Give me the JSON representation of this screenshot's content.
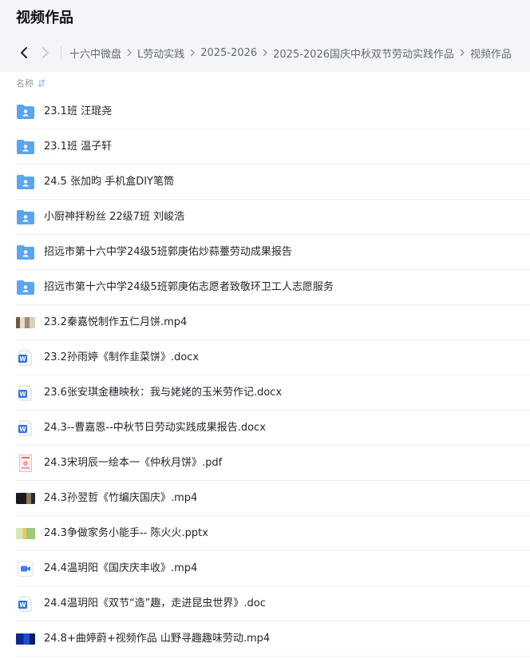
{
  "header": {
    "title": "视频作品"
  },
  "breadcrumb": [
    "十六中微盘",
    "L劳动实践",
    "2025-2026",
    "2025-2026国庆中秋双节劳动实践作品",
    "视频作品"
  ],
  "list_header": {
    "name_label": "名称"
  },
  "files": [
    {
      "name": "23.1班 汪琨尧",
      "icon": "shared-folder-icon"
    },
    {
      "name": "23.1班 温子轩",
      "icon": "shared-folder-icon"
    },
    {
      "name": "24.5 张加昀 手机盒DIY笔筒",
      "icon": "shared-folder-icon"
    },
    {
      "name": "小厨神拌粉丝 22级7班 刘峻浩",
      "icon": "shared-folder-icon"
    },
    {
      "name": "招远市第十六中学24级5班郭庚佑炒蒜薹劳动成果报告",
      "icon": "shared-folder-icon"
    },
    {
      "name": "招远市第十六中学24级5班郭庚佑志愿者致敬环卫工人志愿服务",
      "icon": "shared-folder-icon"
    },
    {
      "name": "23.2秦嘉悦制作五仁月饼.mp4",
      "icon": "video-thumbnail"
    },
    {
      "name": "23.2孙雨婷《制作韭菜饼》.docx",
      "icon": "word-doc-icon"
    },
    {
      "name": "23.6张安琪金穗映秋：我与姥姥的玉米劳作记.docx",
      "icon": "word-doc-icon"
    },
    {
      "name": "24.3--曹嘉恩--中秋节日劳动实践成果报告.docx",
      "icon": "word-doc-icon"
    },
    {
      "name": "24.3宋玥辰一绘本一《仲秋月饼》.pdf",
      "icon": "pdf-thumbnail"
    },
    {
      "name": "24.3孙翌哲《竹编庆国庆》.mp4",
      "icon": "video-thumbnail"
    },
    {
      "name": "24.3争做家务小能手--  陈火火.pptx",
      "icon": "ppt-thumbnail"
    },
    {
      "name": "24.4温玥阳《国庆庆丰收》.mp4",
      "icon": "video-file-icon"
    },
    {
      "name": "24.4温玥阳《双节“造”趣，走进昆虫世界》.doc",
      "icon": "word-doc-icon"
    },
    {
      "name": "24.8+曲婷蔚+视频作品 山野寻趣趣味劳动.mp4",
      "icon": "video-thumbnail"
    }
  ],
  "colors": {
    "folder": "#5aa5f0",
    "word": "#2f6fe0",
    "video": "#3f7cf4",
    "header_bg": "#f3f5f8",
    "divider": "#eceef1"
  }
}
